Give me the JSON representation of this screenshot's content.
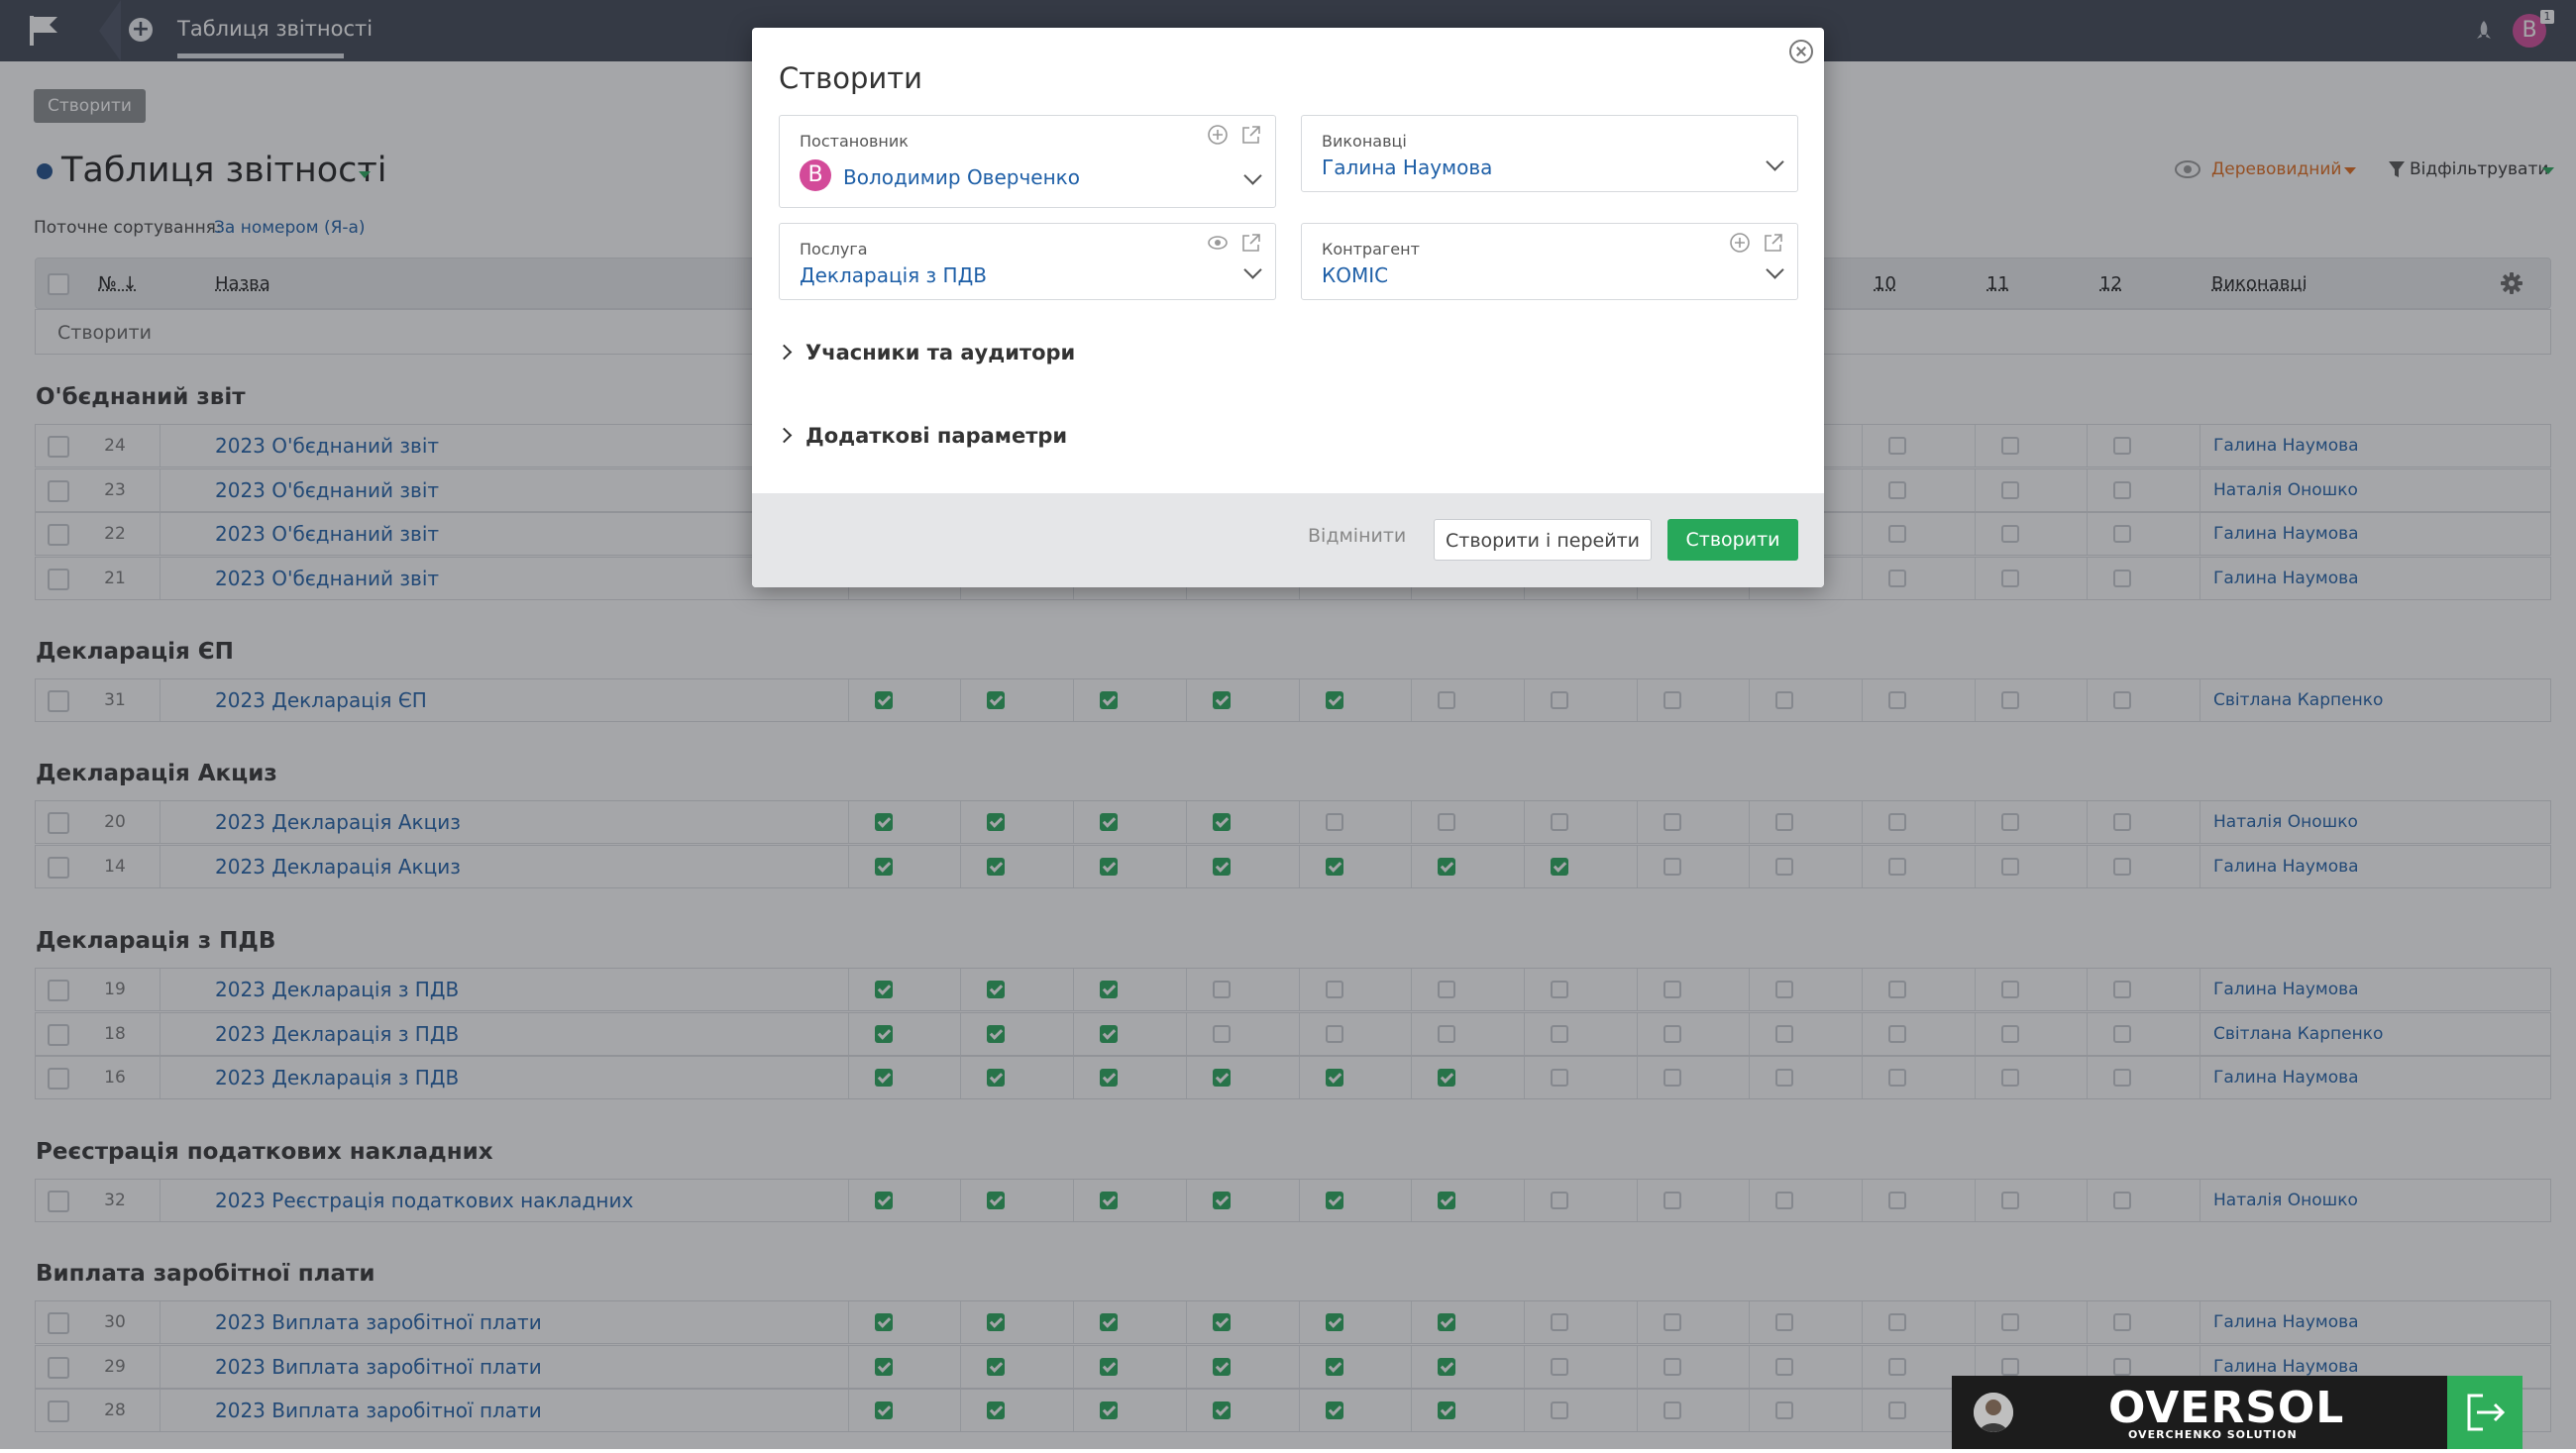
{
  "topbar": {
    "tab_title": "Таблиця звітності",
    "user_initial": "В"
  },
  "page": {
    "create_chip": "Створити",
    "title": "Таблиця звітності",
    "sort_label": "Поточне сортування:",
    "sort_value": "За номером (Я-а)",
    "view_label": "Деревовидний",
    "filter_label": "Відфільтрувати"
  },
  "table": {
    "headers": {
      "num": "№ ↓",
      "name": "Назва",
      "c10": "10",
      "c11": "11",
      "c12": "12",
      "assignees": "Виконавці"
    },
    "new_row": "Створити",
    "groups": [
      {
        "title": "О'бєднаний звіт",
        "rows": [
          {
            "num": "24",
            "name": "2023 О'бєднаний звіт",
            "checks": [
              0,
              0,
              0,
              0,
              0,
              0,
              0,
              0,
              0,
              0,
              0,
              0
            ],
            "person": "Галина Наумова"
          },
          {
            "num": "23",
            "name": "2023 О'бєднаний звіт",
            "checks": [
              0,
              0,
              0,
              0,
              0,
              0,
              0,
              0,
              0,
              0,
              0,
              0
            ],
            "person": "Наталія Оношко"
          },
          {
            "num": "22",
            "name": "2023 О'бєднаний звіт",
            "checks": [
              0,
              0,
              0,
              0,
              0,
              0,
              0,
              0,
              0,
              0,
              0,
              0
            ],
            "person": "Галина Наумова"
          },
          {
            "num": "21",
            "name": "2023 О'бєднаний звіт",
            "checks": [
              0,
              0,
              0,
              0,
              0,
              0,
              0,
              0,
              0,
              0,
              0,
              0
            ],
            "person": "Галина Наумова"
          }
        ]
      },
      {
        "title": "Декларація ЄП",
        "rows": [
          {
            "num": "31",
            "name": "2023 Декларація ЄП",
            "checks": [
              1,
              1,
              1,
              1,
              1,
              0,
              0,
              0,
              0,
              0,
              0,
              0
            ],
            "person": "Світлана Карпенко"
          }
        ]
      },
      {
        "title": "Декларація Акциз",
        "rows": [
          {
            "num": "20",
            "name": "2023 Декларація Акциз",
            "checks": [
              1,
              1,
              1,
              1,
              0,
              0,
              0,
              0,
              0,
              0,
              0,
              0
            ],
            "person": "Наталія Оношко"
          },
          {
            "num": "14",
            "name": "2023 Декларація Акциз",
            "checks": [
              1,
              1,
              1,
              1,
              1,
              1,
              1,
              0,
              0,
              0,
              0,
              0
            ],
            "person": "Галина Наумова"
          }
        ]
      },
      {
        "title": "Декларація з ПДВ",
        "rows": [
          {
            "num": "19",
            "name": "2023 Декларація з ПДВ",
            "checks": [
              1,
              1,
              1,
              0,
              0,
              0,
              0,
              0,
              0,
              0,
              0,
              0
            ],
            "person": "Галина Наумова"
          },
          {
            "num": "18",
            "name": "2023 Декларація з ПДВ",
            "checks": [
              1,
              1,
              1,
              0,
              0,
              0,
              0,
              0,
              0,
              0,
              0,
              0
            ],
            "person": "Світлана Карпенко"
          },
          {
            "num": "16",
            "name": "2023 Декларація з ПДВ",
            "checks": [
              1,
              1,
              1,
              1,
              1,
              1,
              0,
              0,
              0,
              0,
              0,
              0
            ],
            "person": "Галина Наумова"
          }
        ]
      },
      {
        "title": "Реєстрація податкових накладних",
        "rows": [
          {
            "num": "32",
            "name": "2023 Реєстрація податкових накладних",
            "checks": [
              1,
              1,
              1,
              1,
              1,
              1,
              0,
              0,
              0,
              0,
              0,
              0
            ],
            "person": "Наталія Оношко"
          }
        ]
      },
      {
        "title": "Виплата заробітної плати",
        "rows": [
          {
            "num": "30",
            "name": "2023 Виплата заробітної плати",
            "checks": [
              1,
              1,
              1,
              1,
              1,
              1,
              0,
              0,
              0,
              0,
              0,
              0
            ],
            "person": "Галина Наумова"
          },
          {
            "num": "29",
            "name": "2023 Виплата заробітної плати",
            "checks": [
              1,
              1,
              1,
              1,
              1,
              1,
              0,
              0,
              0,
              0,
              0,
              0
            ],
            "person": "Галина Наумова"
          },
          {
            "num": "28",
            "name": "2023 Виплата заробітної плати",
            "checks": [
              1,
              1,
              1,
              1,
              1,
              1,
              0,
              0,
              0,
              0,
              0,
              0
            ],
            "person": ""
          }
        ]
      }
    ]
  },
  "modal": {
    "title": "Створити",
    "author": {
      "label": "Постановник",
      "value": "Володимир Оверченко",
      "initial": "В"
    },
    "assignee": {
      "label": "Виконавці",
      "value": "Галина Наумова"
    },
    "service": {
      "label": "Послуга",
      "value": "Декларація з ПДВ"
    },
    "counterparty": {
      "label": "Контрагент",
      "value": "КОМІС"
    },
    "section_participants": "Учасники та аудитори",
    "section_extra": "Додаткові параметри",
    "cancel": "Відмінити",
    "create_and_go": "Створити і перейти",
    "create": "Створити"
  },
  "brand": {
    "name": "OVERSOL",
    "subtitle": "OVERCHENKO SOLUTION"
  },
  "colors": {
    "accent": "#27a85a",
    "link": "#1e5fa7",
    "topbar": "#3f4654",
    "orange": "#e36c1b"
  }
}
